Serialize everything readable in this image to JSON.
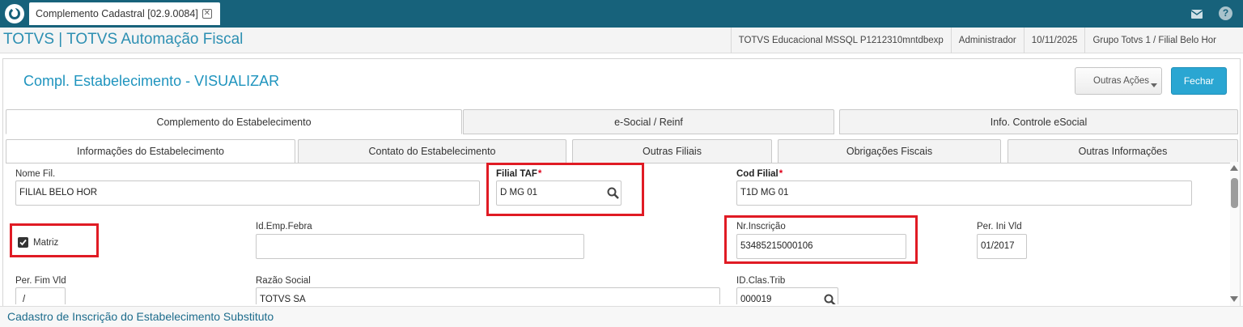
{
  "window": {
    "tab_title": "Complemento Cadastral [02.9.0084]",
    "close_glyph": "✕"
  },
  "topbar": {
    "help_glyph": "?",
    "icons": [
      "totvs-logo-icon",
      "mail-icon",
      "help-icon"
    ]
  },
  "header": {
    "app_title": "TOTVS | TOTVS Automação Fiscal",
    "environment": "TOTVS Educacional MSSQL P1212310mntdbexp",
    "user": "Administrador",
    "date": "10/11/2025",
    "branch": "Grupo Totvs 1 / Filial Belo Hor"
  },
  "page": {
    "title": "Compl. Estabelecimento - VISUALIZAR",
    "actions_label": "Outras Ações",
    "close_label": "Fechar"
  },
  "tabs_top": [
    {
      "label": "Complemento do Estabelecimento"
    },
    {
      "label": "e-Social / Reinf"
    },
    {
      "label": "Info. Controle eSocial"
    }
  ],
  "tabs_sub": [
    {
      "label": "Informações do Estabelecimento"
    },
    {
      "label": "Contato do Estabelecimento"
    },
    {
      "label": "Outras Filiais"
    },
    {
      "label": "Obrigações Fiscais"
    },
    {
      "label": "Outras Informações"
    }
  ],
  "form": {
    "nome_fil": {
      "label": "Nome Fil.",
      "value": "FILIAL BELO HOR"
    },
    "filial_taf": {
      "label": "Filial TAF",
      "value": "D MG 01",
      "required_mark": "*"
    },
    "cod_filial": {
      "label": "Cod Filial",
      "value": "T1D MG 01",
      "required_mark": "*"
    },
    "matriz": {
      "label": "Matriz",
      "checked": true
    },
    "id_emp_febra": {
      "label": "Id.Emp.Febra",
      "value": ""
    },
    "nr_inscricao": {
      "label": "Nr.Inscrição",
      "value": "53485215000106"
    },
    "per_ini_vld": {
      "label": "Per. Ini Vld",
      "value": "01/2017"
    },
    "per_fim_vld": {
      "label": "Per. Fim Vld",
      "value": "/"
    },
    "razao_social": {
      "label": "Razão Social",
      "value": "TOTVS SA"
    },
    "id_clas_trib": {
      "label": "ID.Clas.Trib",
      "value": "000019"
    }
  },
  "footer": {
    "section_link": "Cadastro de Inscrição do Estabelecimento Substituto"
  },
  "colors": {
    "topbar": "#17627b",
    "accent": "#2aa6d2",
    "highlight": "#e01b24",
    "title": "#1f94be"
  }
}
